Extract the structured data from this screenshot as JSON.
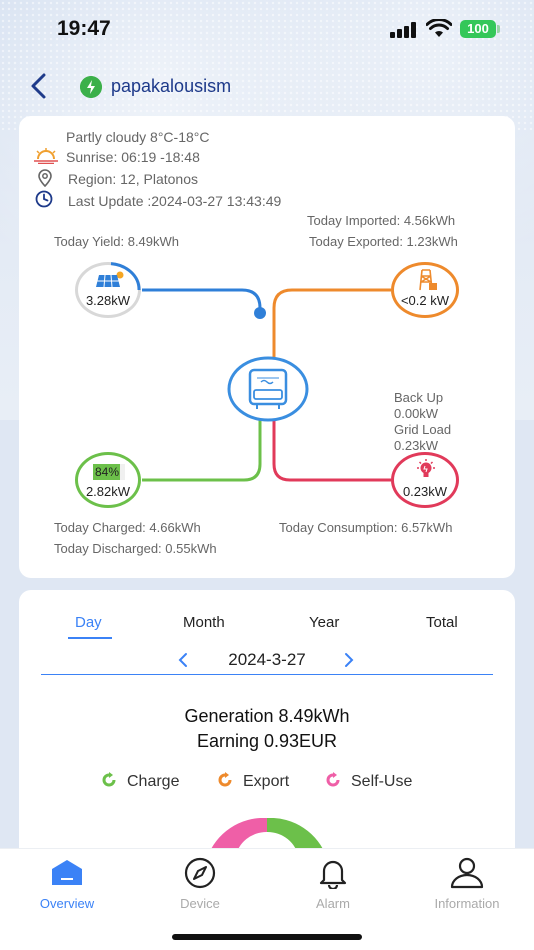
{
  "status_bar": {
    "time": "19:47",
    "battery": "100"
  },
  "header": {
    "plant_name": "papakalousism"
  },
  "weather": {
    "condition": "Partly cloudy 8°C-18°C",
    "sun": "Sunrise: 06:19 -18:48",
    "region": "Region: 12, Platonos",
    "last_update": "Last Update :2024-03-27 13:43:49"
  },
  "flow": {
    "today_imported": "Today Imported: 4.56kWh",
    "today_exported": "Today Exported: 1.23kWh",
    "today_yield": "Today Yield: 8.49kWh",
    "pv_power": "3.28kW",
    "grid_power": "<0.2 kW",
    "backup_label": "Back Up",
    "backup_value": "0.00kW",
    "gridload_label": "Grid Load",
    "gridload_value": "0.23kW",
    "battery_soc": "84%",
    "battery_soc_fraction": 0.84,
    "battery_power": "2.82kW",
    "load_power": "0.23kW",
    "today_charged": "Today Charged: 4.66kWh",
    "today_discharged": "Today Discharged: 0.55kWh",
    "today_consumption": "Today Consumption: 6.57kWh",
    "colors": {
      "pv": "#2f7fd8",
      "grid": "#ee8a2c",
      "battery": "#6cc04a",
      "load": "#e13a5a",
      "inverter": "#3a8ee0"
    }
  },
  "chart_panel": {
    "tabs": [
      "Day",
      "Month",
      "Year",
      "Total"
    ],
    "active_tab": "Day",
    "date": "2024-3-27",
    "generation": "Generation 8.49kWh",
    "earning": "Earning 0.93EUR",
    "legend": [
      {
        "label": "Charge",
        "color": "#6cc04a"
      },
      {
        "label": "Export",
        "color": "#ee8a2c"
      },
      {
        "label": "Self-Use",
        "color": "#ef5fa7"
      }
    ]
  },
  "tab_bar": {
    "items": [
      {
        "label": "Overview",
        "icon": "home-icon"
      },
      {
        "label": "Device",
        "icon": "compass-icon"
      },
      {
        "label": "Alarm",
        "icon": "bell-icon"
      },
      {
        "label": "Information",
        "icon": "user-icon"
      }
    ],
    "active": "Overview",
    "accent": "#3b82f6"
  }
}
